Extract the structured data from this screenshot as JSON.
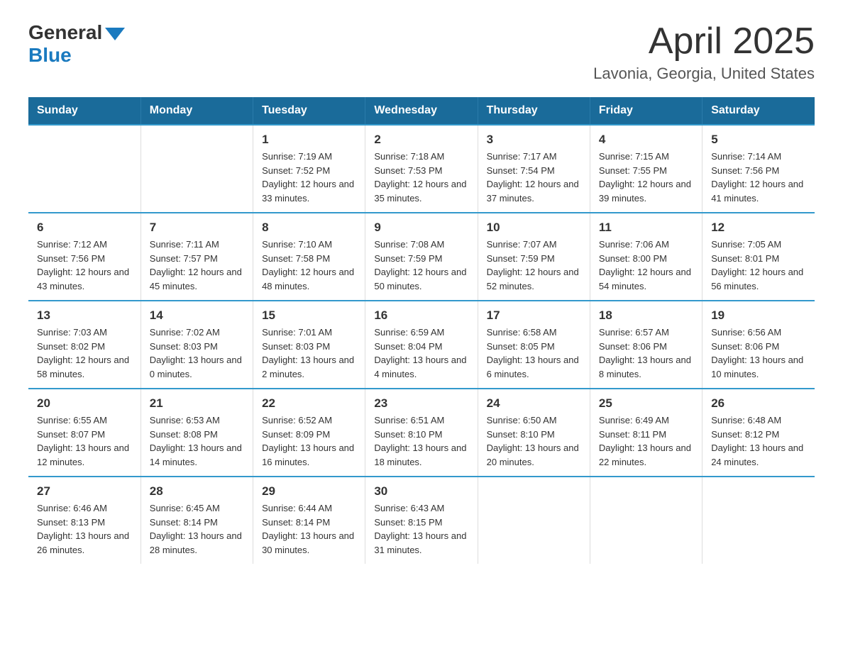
{
  "header": {
    "logo": {
      "general": "General",
      "blue": "Blue"
    },
    "title": "April 2025",
    "subtitle": "Lavonia, Georgia, United States"
  },
  "days_of_week": [
    "Sunday",
    "Monday",
    "Tuesday",
    "Wednesday",
    "Thursday",
    "Friday",
    "Saturday"
  ],
  "weeks": [
    [
      {
        "day": "",
        "info": ""
      },
      {
        "day": "",
        "info": ""
      },
      {
        "day": "1",
        "info": "Sunrise: 7:19 AM\nSunset: 7:52 PM\nDaylight: 12 hours and 33 minutes."
      },
      {
        "day": "2",
        "info": "Sunrise: 7:18 AM\nSunset: 7:53 PM\nDaylight: 12 hours and 35 minutes."
      },
      {
        "day": "3",
        "info": "Sunrise: 7:17 AM\nSunset: 7:54 PM\nDaylight: 12 hours and 37 minutes."
      },
      {
        "day": "4",
        "info": "Sunrise: 7:15 AM\nSunset: 7:55 PM\nDaylight: 12 hours and 39 minutes."
      },
      {
        "day": "5",
        "info": "Sunrise: 7:14 AM\nSunset: 7:56 PM\nDaylight: 12 hours and 41 minutes."
      }
    ],
    [
      {
        "day": "6",
        "info": "Sunrise: 7:12 AM\nSunset: 7:56 PM\nDaylight: 12 hours and 43 minutes."
      },
      {
        "day": "7",
        "info": "Sunrise: 7:11 AM\nSunset: 7:57 PM\nDaylight: 12 hours and 45 minutes."
      },
      {
        "day": "8",
        "info": "Sunrise: 7:10 AM\nSunset: 7:58 PM\nDaylight: 12 hours and 48 minutes."
      },
      {
        "day": "9",
        "info": "Sunrise: 7:08 AM\nSunset: 7:59 PM\nDaylight: 12 hours and 50 minutes."
      },
      {
        "day": "10",
        "info": "Sunrise: 7:07 AM\nSunset: 7:59 PM\nDaylight: 12 hours and 52 minutes."
      },
      {
        "day": "11",
        "info": "Sunrise: 7:06 AM\nSunset: 8:00 PM\nDaylight: 12 hours and 54 minutes."
      },
      {
        "day": "12",
        "info": "Sunrise: 7:05 AM\nSunset: 8:01 PM\nDaylight: 12 hours and 56 minutes."
      }
    ],
    [
      {
        "day": "13",
        "info": "Sunrise: 7:03 AM\nSunset: 8:02 PM\nDaylight: 12 hours and 58 minutes."
      },
      {
        "day": "14",
        "info": "Sunrise: 7:02 AM\nSunset: 8:03 PM\nDaylight: 13 hours and 0 minutes."
      },
      {
        "day": "15",
        "info": "Sunrise: 7:01 AM\nSunset: 8:03 PM\nDaylight: 13 hours and 2 minutes."
      },
      {
        "day": "16",
        "info": "Sunrise: 6:59 AM\nSunset: 8:04 PM\nDaylight: 13 hours and 4 minutes."
      },
      {
        "day": "17",
        "info": "Sunrise: 6:58 AM\nSunset: 8:05 PM\nDaylight: 13 hours and 6 minutes."
      },
      {
        "day": "18",
        "info": "Sunrise: 6:57 AM\nSunset: 8:06 PM\nDaylight: 13 hours and 8 minutes."
      },
      {
        "day": "19",
        "info": "Sunrise: 6:56 AM\nSunset: 8:06 PM\nDaylight: 13 hours and 10 minutes."
      }
    ],
    [
      {
        "day": "20",
        "info": "Sunrise: 6:55 AM\nSunset: 8:07 PM\nDaylight: 13 hours and 12 minutes."
      },
      {
        "day": "21",
        "info": "Sunrise: 6:53 AM\nSunset: 8:08 PM\nDaylight: 13 hours and 14 minutes."
      },
      {
        "day": "22",
        "info": "Sunrise: 6:52 AM\nSunset: 8:09 PM\nDaylight: 13 hours and 16 minutes."
      },
      {
        "day": "23",
        "info": "Sunrise: 6:51 AM\nSunset: 8:10 PM\nDaylight: 13 hours and 18 minutes."
      },
      {
        "day": "24",
        "info": "Sunrise: 6:50 AM\nSunset: 8:10 PM\nDaylight: 13 hours and 20 minutes."
      },
      {
        "day": "25",
        "info": "Sunrise: 6:49 AM\nSunset: 8:11 PM\nDaylight: 13 hours and 22 minutes."
      },
      {
        "day": "26",
        "info": "Sunrise: 6:48 AM\nSunset: 8:12 PM\nDaylight: 13 hours and 24 minutes."
      }
    ],
    [
      {
        "day": "27",
        "info": "Sunrise: 6:46 AM\nSunset: 8:13 PM\nDaylight: 13 hours and 26 minutes."
      },
      {
        "day": "28",
        "info": "Sunrise: 6:45 AM\nSunset: 8:14 PM\nDaylight: 13 hours and 28 minutes."
      },
      {
        "day": "29",
        "info": "Sunrise: 6:44 AM\nSunset: 8:14 PM\nDaylight: 13 hours and 30 minutes."
      },
      {
        "day": "30",
        "info": "Sunrise: 6:43 AM\nSunset: 8:15 PM\nDaylight: 13 hours and 31 minutes."
      },
      {
        "day": "",
        "info": ""
      },
      {
        "day": "",
        "info": ""
      },
      {
        "day": "",
        "info": ""
      }
    ]
  ]
}
